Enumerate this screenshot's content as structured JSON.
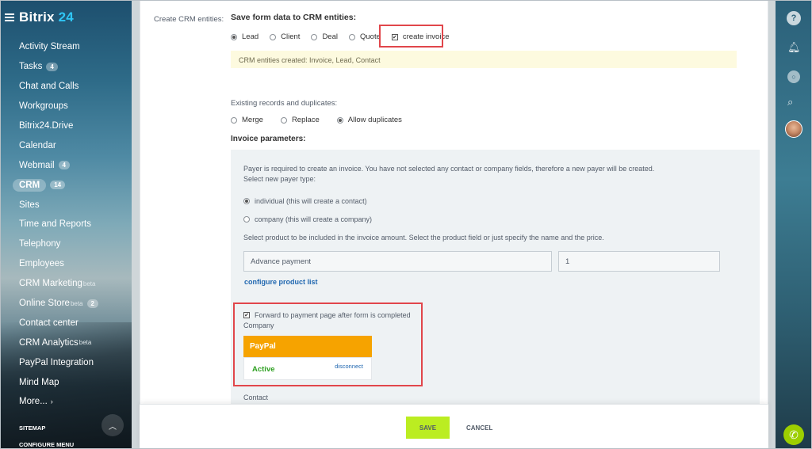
{
  "brand": {
    "name": "Bitrix",
    "num": "24"
  },
  "sidebar": {
    "items": [
      {
        "label": "Activity Stream"
      },
      {
        "label": "Tasks",
        "count": "4"
      },
      {
        "label": "Chat and Calls"
      },
      {
        "label": "Workgroups"
      },
      {
        "label": "Bitrix24.Drive"
      },
      {
        "label": "Calendar"
      },
      {
        "label": "Webmail",
        "count": "4"
      },
      {
        "label": "CRM",
        "count": "14",
        "active": true
      },
      {
        "label": "Sites"
      },
      {
        "label": "Time and Reports"
      },
      {
        "label": "Telephony"
      },
      {
        "label": "Employees"
      },
      {
        "label": "CRM Marketing",
        "sup": "beta"
      },
      {
        "label": "Online Store",
        "sup": "beta",
        "count": "2"
      },
      {
        "label": "Contact center"
      },
      {
        "label": "CRM Analytics",
        "sup": "beta"
      },
      {
        "label": "PayPal Integration"
      },
      {
        "label": "Mind Map"
      },
      {
        "label": "More...",
        "arrow": "›"
      }
    ],
    "sitemap": "SITEMAP",
    "configure_menu": "CONFIGURE MENU"
  },
  "rightbar": {
    "icons": [
      "help-icon",
      "bell-icon",
      "chat-icon",
      "search-icon",
      "avatar",
      "phone-icon"
    ]
  },
  "form": {
    "crm_label": "Create CRM entities:",
    "save_title": "Save form data to CRM entities:",
    "entities": [
      {
        "label": "Lead",
        "checked": true
      },
      {
        "label": "Client",
        "checked": false
      },
      {
        "label": "Deal",
        "checked": false
      },
      {
        "label": "Quote",
        "checked": false
      }
    ],
    "create_invoice": {
      "label": "create invoice",
      "checked": true
    },
    "notice": "CRM entities created: Invoice, Lead, Contact",
    "duplicates_label": "Existing records and duplicates:",
    "duplicates": [
      {
        "label": "Merge",
        "checked": false
      },
      {
        "label": "Replace",
        "checked": false
      },
      {
        "label": "Allow duplicates",
        "checked": true
      }
    ],
    "invoice_title": "Invoice parameters:",
    "payer_info": "Payer is required to create an invoice. You have not selected any contact or company fields, therefore a new payer will be created.",
    "payer_type_label": "Select new payer type:",
    "payer_types": [
      {
        "label": "individual (this will create a contact)",
        "checked": true
      },
      {
        "label": "company (this will create a company)",
        "checked": false
      }
    ],
    "product_info": "Select product to be included in the invoice amount. Select the product field or just specify the name and the price.",
    "product_name": "Advance payment",
    "product_qty": "1",
    "configure_link": "configure product list",
    "forward_label": "Forward to payment page after form is completed",
    "forward_checked": true,
    "company_label": "Company",
    "paypal": {
      "name": "PayPal",
      "status": "Active",
      "disconnect": "disconnect"
    },
    "contact_label": "Contact"
  },
  "footer": {
    "save": "SAVE",
    "cancel": "CANCEL"
  },
  "colors": {
    "accent_red": "#e1464b",
    "save_green": "#bbed21",
    "paypal_orange": "#f6a300",
    "link_blue": "#2067b0"
  }
}
